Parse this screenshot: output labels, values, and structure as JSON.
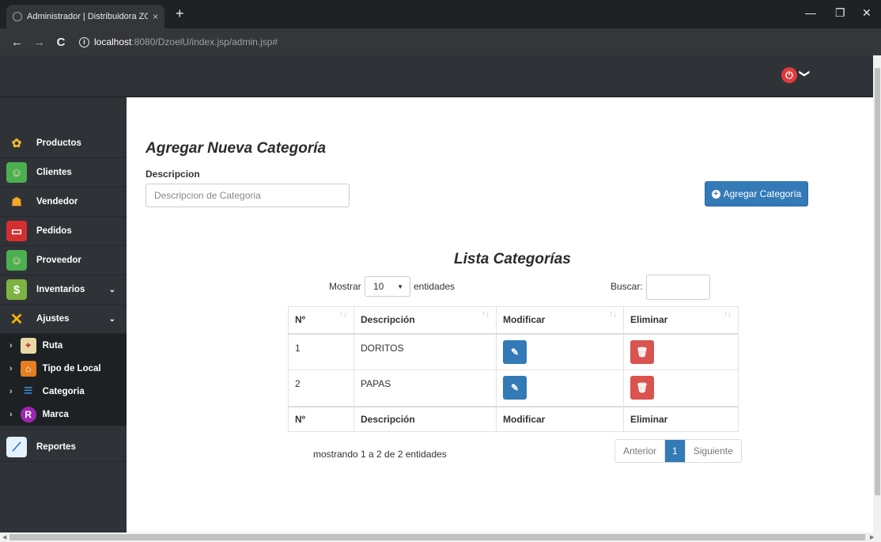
{
  "browser": {
    "tab_title": "Administrador | Distribuidora ZO",
    "tab_close": "×",
    "new_tab": "+",
    "url_host": "localhost",
    "url_path": ":8080/DzoelU/index.jsp/admin.jsp#",
    "back": "←",
    "forward": "→",
    "reload": "C",
    "info": "i",
    "star": "☆",
    "key": "o-",
    "minimize": "—",
    "maximize": "❐",
    "close": "✕",
    "menu": "⋮"
  },
  "topbar": {
    "power": "⏻",
    "caret": "❯"
  },
  "sidebar": {
    "items": [
      {
        "label": "Productos",
        "icon": "wheat-icon",
        "glyph": "✿"
      },
      {
        "label": "Clientes",
        "icon": "client-icon",
        "glyph": "☺"
      },
      {
        "label": "Vendedor",
        "icon": "seller-icon",
        "glyph": "☗"
      },
      {
        "label": "Pedidos",
        "icon": "basket-icon",
        "glyph": "▭"
      },
      {
        "label": "Proveedor",
        "icon": "supplier-icon",
        "glyph": "☺"
      },
      {
        "label": "Inventarios",
        "icon": "ledger-icon",
        "glyph": "$"
      },
      {
        "label": "Ajustes",
        "icon": "tools-icon",
        "glyph": "✕"
      }
    ],
    "subitems": [
      {
        "label": "Ruta",
        "icon": "map-icon",
        "glyph": "⌖"
      },
      {
        "label": "Tipo de Local",
        "icon": "store-icon",
        "glyph": "⌂"
      },
      {
        "label": "Categoria",
        "icon": "list-icon",
        "glyph": "≡"
      },
      {
        "label": "Marca",
        "icon": "brand-icon",
        "glyph": "R"
      }
    ],
    "reportes": {
      "label": "Reportes",
      "icon": "chart-icon",
      "glyph": "⟋"
    },
    "chevron": "⌄",
    "sub_arrow": "›"
  },
  "form": {
    "title": "Agregar Nueva Categoría",
    "label": "Descripcion",
    "placeholder": "Descripcion de Categoria",
    "button": "Agregar Categoría",
    "button_icon": "+"
  },
  "list": {
    "title": "Lista Categorías",
    "show": "Mostrar",
    "entries_value": "10",
    "entries": "entidades",
    "search": "Buscar:",
    "columns": [
      "Nº",
      "Descripción",
      "Modificar",
      "Eliminar"
    ],
    "rows": [
      {
        "n": "1",
        "descripcion": "DORITOS"
      },
      {
        "n": "2",
        "descripcion": "PAPAS"
      }
    ],
    "info": "mostrando 1 a 2 de 2 entidades",
    "prev": "Anterior",
    "page": "1",
    "next": "Siguiente",
    "edit_glyph": "✎",
    "delete_glyph": "🗑"
  },
  "colors": {
    "primary": "#337ab7",
    "danger": "#d9534f",
    "sidebar": "#2f3338",
    "power": "#e03b3b"
  }
}
